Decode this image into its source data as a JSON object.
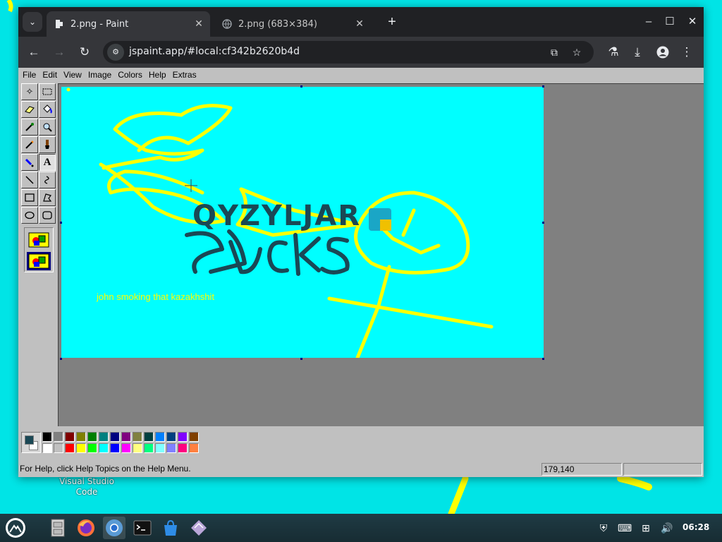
{
  "desktop": {
    "icon_label": "Visual Studio Code"
  },
  "browser": {
    "tabs": [
      {
        "title": "2.png - Paint",
        "favicon": "paint-favicon",
        "active": true
      },
      {
        "title": "2.png (683×384)",
        "favicon": "globe-icon",
        "active": false
      }
    ],
    "url": "jspaint.app/#local:cf342b2620b4d",
    "window_controls": {
      "minimize": "–",
      "maximize": "☐",
      "close": "✕"
    }
  },
  "paint": {
    "menu": [
      "File",
      "Edit",
      "View",
      "Image",
      "Colors",
      "Help",
      "Extras"
    ],
    "tools": [
      "free-form-select",
      "select",
      "eraser",
      "fill-with-color",
      "pick-color",
      "magnifier",
      "pencil",
      "brush",
      "airbrush",
      "text",
      "line",
      "curve",
      "rectangle",
      "polygon",
      "ellipse",
      "rounded-rectangle"
    ],
    "selected_tool": "text",
    "canvas": {
      "logo_text": "QYZYLJAR",
      "handwriting": "SUCKS",
      "caption": "john smoking that kazakhshit"
    },
    "colors": {
      "foreground": "#1a4855",
      "background": "#ffffff",
      "palette_top": [
        "#000000",
        "#808080",
        "#800000",
        "#808000",
        "#008000",
        "#008080",
        "#000080",
        "#800080",
        "#808040",
        "#004040",
        "#0080ff",
        "#004080",
        "#8000ff",
        "#804000"
      ],
      "palette_bottom": [
        "#ffffff",
        "#c0c0c0",
        "#ff0000",
        "#ffff00",
        "#00ff00",
        "#00ffff",
        "#0000ff",
        "#ff00ff",
        "#ffff80",
        "#00ff80",
        "#80ffff",
        "#8080ff",
        "#ff0080",
        "#ff8040"
      ]
    },
    "status": {
      "help_text": "For Help, click Help Topics on the Help Menu.",
      "coordinates": "179,140",
      "selection_size": ""
    }
  },
  "taskbar": {
    "apps": [
      "files",
      "firefox",
      "chromium",
      "terminal",
      "store",
      "app"
    ],
    "active_app": "chromium",
    "clock": "06:28"
  }
}
